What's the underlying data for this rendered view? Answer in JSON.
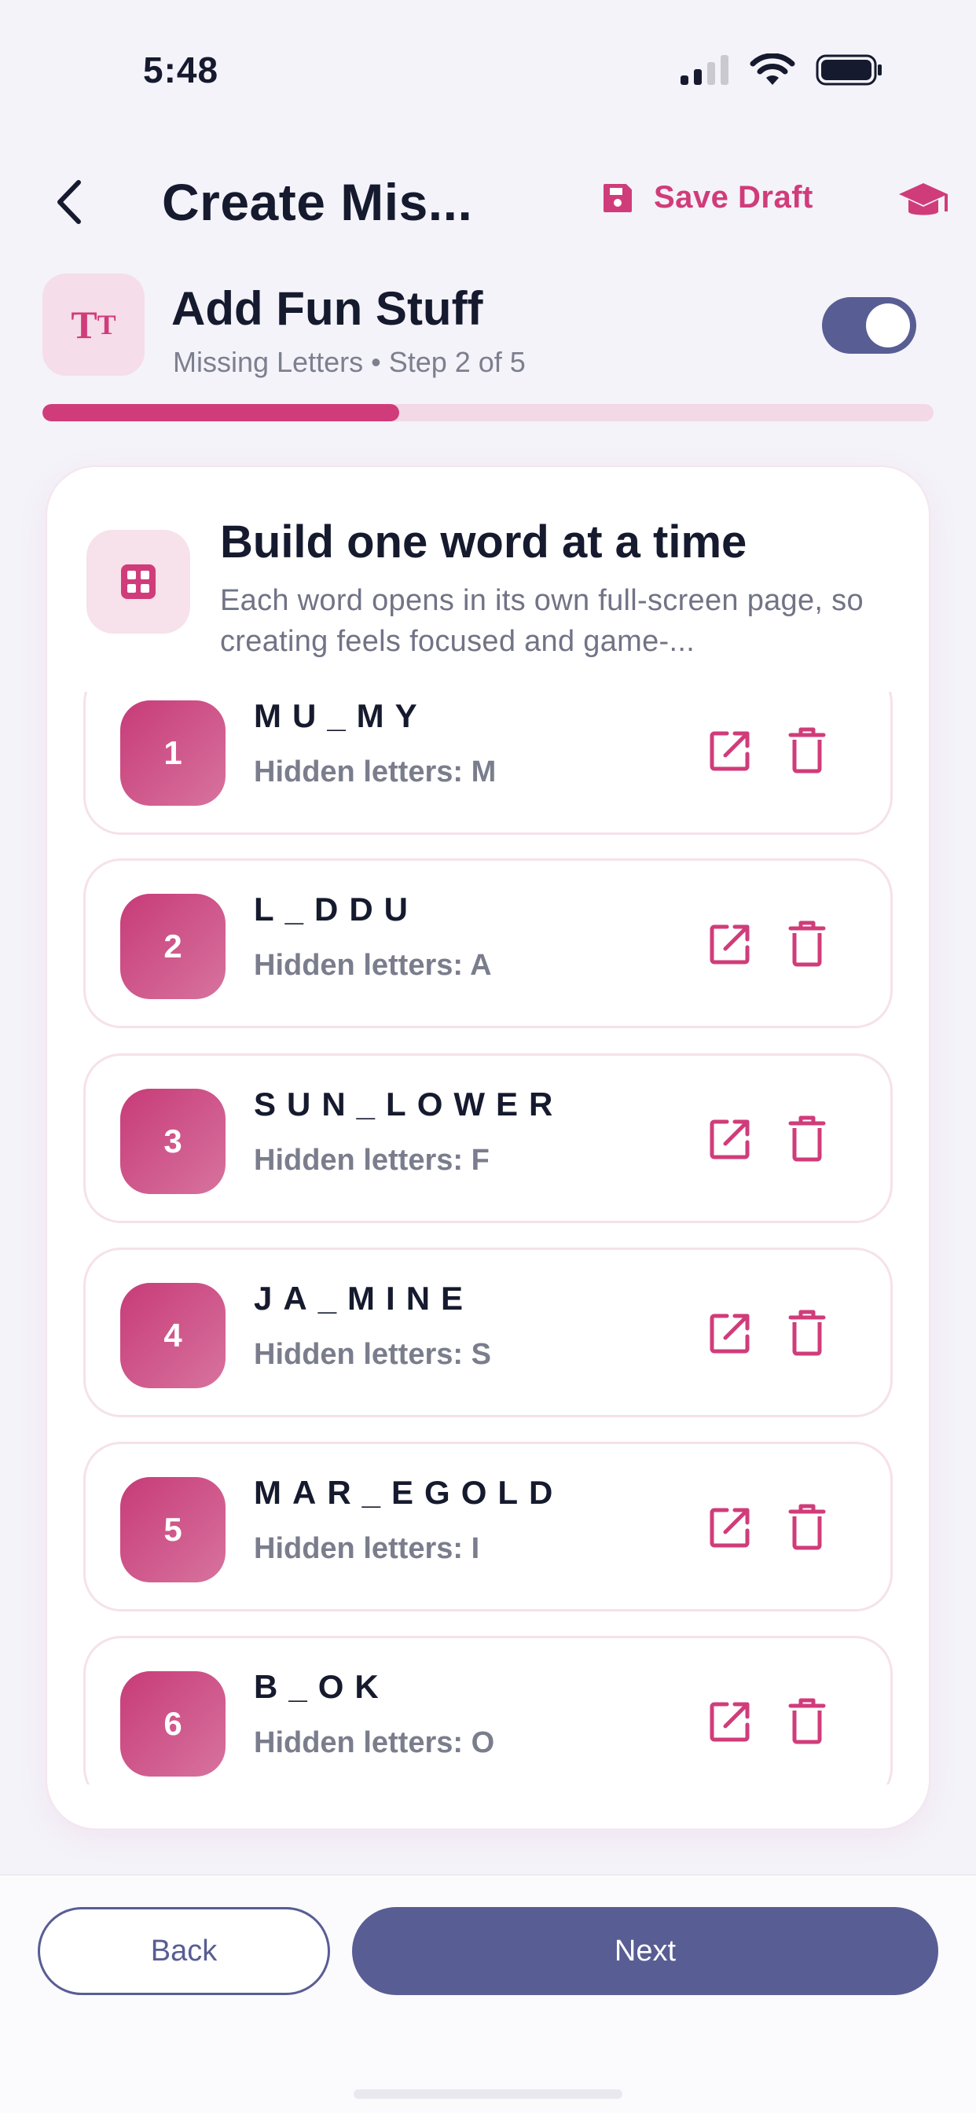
{
  "status_bar": {
    "time": "5:48"
  },
  "nav": {
    "title": "Create Mis...",
    "save_draft_label": "Save Draft"
  },
  "section": {
    "badge_glyph_big": "T",
    "badge_glyph_small": "T",
    "title": "Add Fun Stuff",
    "subtitle": "Missing Letters • Step 2 of 5",
    "toggle_on": true
  },
  "progress": {
    "fraction": 0.4
  },
  "card": {
    "title": "Build one word at a time",
    "description": "Each word opens in its own full-screen page, so creating feels focused and game-..."
  },
  "words": [
    {
      "number": "1",
      "word": "MU_MY",
      "hidden": "Hidden letters: M"
    },
    {
      "number": "2",
      "word": "L_DDU",
      "hidden": "Hidden letters: A"
    },
    {
      "number": "3",
      "word": "SUN_LOWER",
      "hidden": "Hidden letters: F"
    },
    {
      "number": "4",
      "word": "JA_MINE",
      "hidden": "Hidden letters: S"
    },
    {
      "number": "5",
      "word": "MAR_EGOLD",
      "hidden": "Hidden letters: I"
    },
    {
      "number": "6",
      "word": "B_OK",
      "hidden": "Hidden letters: O"
    }
  ],
  "footer": {
    "back_label": "Back",
    "next_label": "Next"
  },
  "colors": {
    "accent": "#d03c7a",
    "primary": "#585d94",
    "background": "#f4f3fa"
  }
}
